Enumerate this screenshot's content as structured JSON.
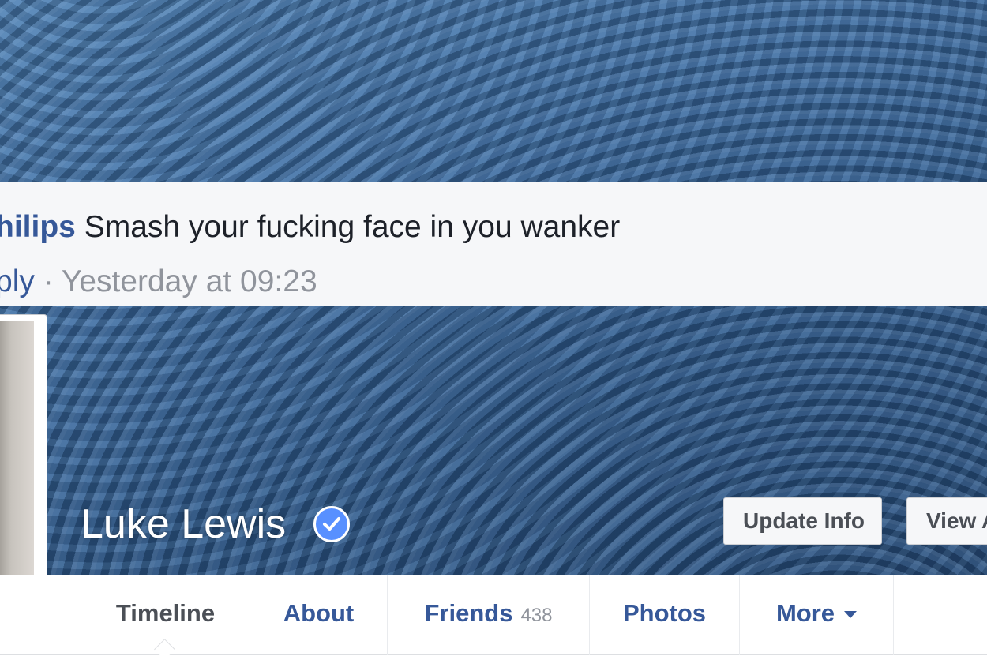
{
  "comment": {
    "author_fragment": "hilips",
    "text": "Smash your fucking face in you wanker",
    "reply_fragment": "ply",
    "separator": "·",
    "timestamp": "Yesterday at 09:23"
  },
  "profile": {
    "name": "Luke Lewis",
    "verified": true
  },
  "cover_buttons": {
    "update_info": "Update Info",
    "view_fragment": "View A"
  },
  "tabs": [
    {
      "label": "Timeline"
    },
    {
      "label": "About"
    },
    {
      "label": "Friends",
      "count": "438"
    },
    {
      "label": "Photos"
    },
    {
      "label": "More"
    }
  ],
  "colors": {
    "link_blue": "#365899",
    "verified_blue": "#5890ff",
    "meta_gray": "#90949c"
  }
}
